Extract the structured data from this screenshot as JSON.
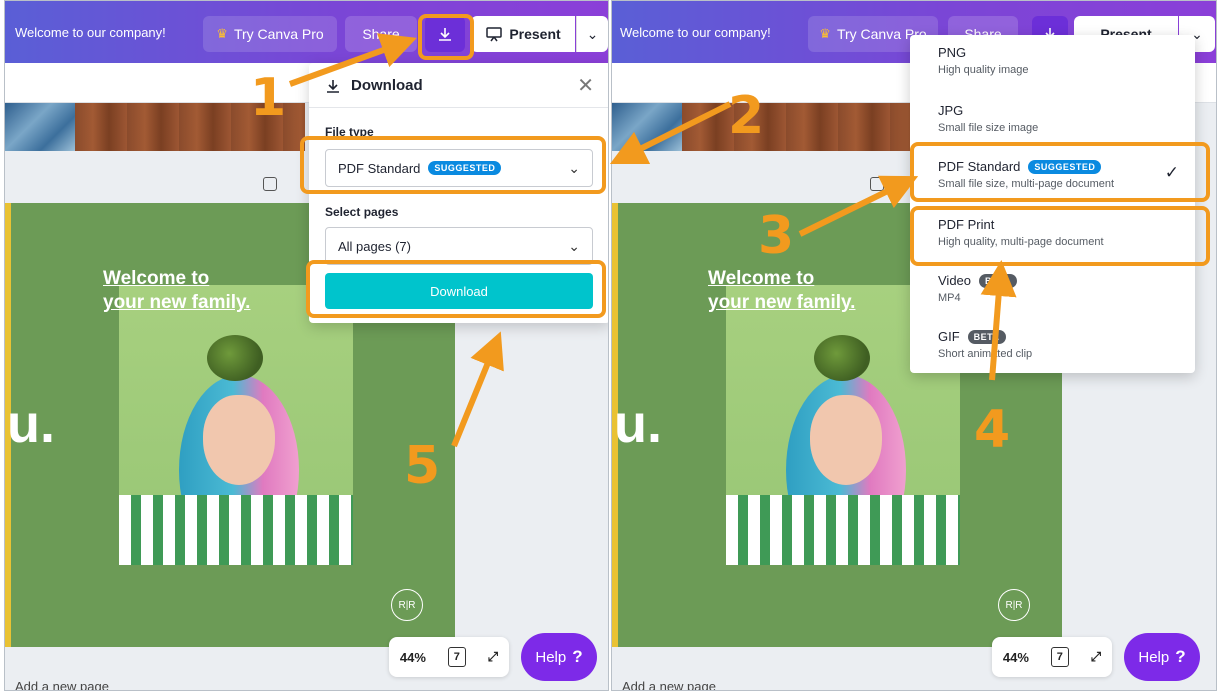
{
  "topbar": {
    "title": "Welcome to our company!",
    "try_pro_label": "Try Canva Pro",
    "share_label": "Share",
    "present_label": "Present",
    "right_present_label": "Present",
    "right_share_label": "Share"
  },
  "download_panel": {
    "title": "Download",
    "file_type_label": "File type",
    "file_type_value": "PDF Standard",
    "file_type_badge": "SUGGESTED",
    "select_pages_label": "Select pages",
    "select_pages_value": "All pages (7)",
    "download_button": "Download"
  },
  "file_type_menu": {
    "options": [
      {
        "name": "PNG",
        "desc": "High quality image",
        "badge": ""
      },
      {
        "name": "JPG",
        "desc": "Small file size image",
        "badge": ""
      },
      {
        "name": "PDF Standard",
        "desc": "Small file size, multi-page document",
        "badge": "SUGGESTED",
        "selected": true
      },
      {
        "name": "PDF Print",
        "desc": "High quality, multi-page document",
        "badge": ""
      },
      {
        "name": "Video",
        "desc": "MP4",
        "badge": "BETA"
      },
      {
        "name": "GIF",
        "desc": "Short animated clip",
        "badge": "BETA"
      }
    ]
  },
  "canvas": {
    "heading_line1": "Welcome to",
    "heading_line2": "your new family.",
    "big_letter": "u.",
    "logo_mark": "R|R"
  },
  "footer": {
    "zoom": "44%",
    "page_count": "7",
    "help_label": "Help",
    "help_mark": "?",
    "add_page": "Add a new page"
  },
  "steps": [
    "1",
    "2",
    "3",
    "4",
    "5"
  ],
  "colors": {
    "accent": "#7d2ae8",
    "download_button": "#00c4cc",
    "highlight": "#f29a1e",
    "canvas_green": "#6c9b56"
  }
}
